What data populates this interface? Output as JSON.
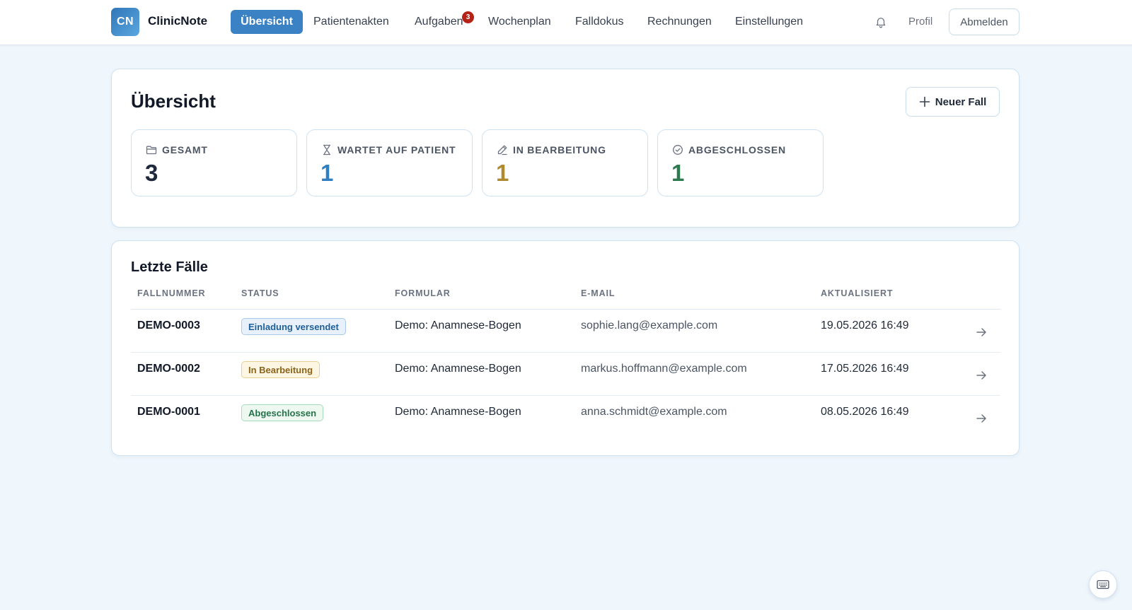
{
  "brand": {
    "logo_text": "CN",
    "name": "ClinicNote"
  },
  "nav": {
    "items": [
      {
        "label": "Übersicht",
        "active": true
      },
      {
        "label": "Patientenakten",
        "active": false
      },
      {
        "label": "Aufgaben",
        "active": false,
        "badge": "3"
      },
      {
        "label": "Wochenplan",
        "active": false
      },
      {
        "label": "Falldokus",
        "active": false
      },
      {
        "label": "Rechnungen",
        "active": false
      },
      {
        "label": "Einstellungen",
        "active": false
      }
    ],
    "bell_icon": "bell-icon",
    "profile_label": "Profil",
    "logout_label": "Abmelden"
  },
  "overview": {
    "title": "Übersicht",
    "new_case_label": "Neuer Fall",
    "stats": [
      {
        "label": "GESAMT",
        "value": "3",
        "icon": "folder-icon",
        "color": "#1e293b"
      },
      {
        "label": "WARTET AUF PATIENT",
        "value": "1",
        "icon": "hourglass-icon",
        "color": "#2f7fc1"
      },
      {
        "label": "IN BEARBEITUNG",
        "value": "1",
        "icon": "pencil-icon",
        "color": "#b08a2e"
      },
      {
        "label": "ABGESCHLOSSEN",
        "value": "1",
        "icon": "check-circle-icon",
        "color": "#2e7a4f"
      }
    ]
  },
  "recent": {
    "title": "Letzte Fälle",
    "columns": [
      "FALLNUMMER",
      "STATUS",
      "FORMULAR",
      "E-MAIL",
      "AKTUALISIERT"
    ],
    "rows": [
      {
        "id": "DEMO-0003",
        "status": "Einladung versendet",
        "status_kind": "info",
        "form": "Demo: Anamnese-Bogen",
        "email": "sophie.lang@example.com",
        "updated": "19.05.2026 16:49"
      },
      {
        "id": "DEMO-0002",
        "status": "In Bearbeitung",
        "status_kind": "warning",
        "form": "Demo: Anamnese-Bogen",
        "email": "markus.hoffmann@example.com",
        "updated": "17.05.2026 16:49"
      },
      {
        "id": "DEMO-0001",
        "status": "Abgeschlossen",
        "status_kind": "success",
        "form": "Demo: Anamnese-Bogen",
        "email": "anna.schmidt@example.com",
        "updated": "08.05.2026 16:49"
      }
    ]
  },
  "colors": {
    "accent": "#3b82c4",
    "badge": "#b42318",
    "status_info_bg": "#e8f1fb",
    "status_info_border": "#a9c9ea",
    "status_info_text": "#1f5f99",
    "status_warning_bg": "#fdf6e3",
    "status_warning_border": "#e9cf8d",
    "status_warning_text": "#8a6418",
    "status_success_bg": "#edf8f1",
    "status_success_border": "#a8dbbb",
    "status_success_text": "#25734a"
  }
}
